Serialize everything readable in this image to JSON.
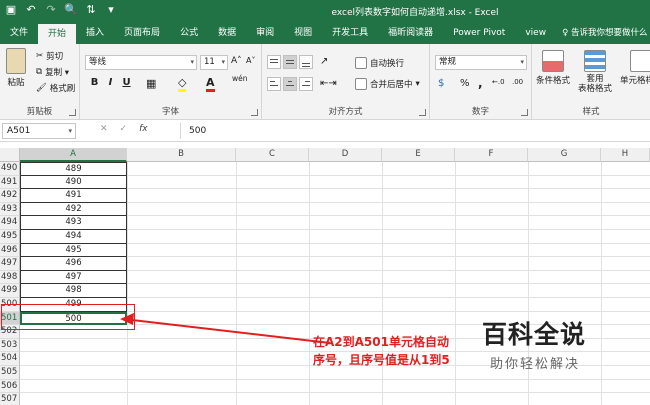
{
  "titlebar": {
    "title": "excel列表数字如何自动递增.xlsx  -  Excel",
    "qat": [
      "save-icon",
      "undo-icon",
      "redo-icon",
      "print-preview-icon",
      "sort-icon",
      "customize-icon"
    ],
    "qat_glyphs": [
      "▣",
      "↶",
      "↷",
      "🔍",
      "⇅",
      "▾"
    ]
  },
  "tabs": [
    "文件",
    "开始",
    "插入",
    "页面布局",
    "公式",
    "数据",
    "审阅",
    "视图",
    "开发工具",
    "福昕阅读器",
    "Power Pivot",
    "view"
  ],
  "tell_me": "♀ 告诉我你想要做什么",
  "ribbon": {
    "clipboard": {
      "paste": "粘贴",
      "cut": "剪切",
      "copy": "复制 ▾",
      "painter": "格式刷",
      "label": "剪贴板"
    },
    "font": {
      "name": "等线",
      "size": "11",
      "grow": "A˄",
      "shrink": "A˅",
      "bold": "B",
      "italic": "I",
      "underline": "U",
      "border": "▦",
      "fill": "◇",
      "color": "A",
      "wen": "wén",
      "label": "字体"
    },
    "alignment": {
      "wrap": "自动换行",
      "merge": "合并后居中",
      "label": "对齐方式"
    },
    "number": {
      "format": "常规",
      "currency": "$",
      "percent": "%",
      "comma": ",",
      "inc": "←.0",
      "dec": ".00",
      "label": "数字"
    },
    "styles": {
      "conditional": "条件格式",
      "table": "套用\n表格格式",
      "cell": "单元格样式",
      "label": "样式"
    }
  },
  "formula_bar": {
    "name_box": "A501",
    "cancel": "✕",
    "enter": "✓",
    "fx": "fx",
    "value": "500"
  },
  "columns": [
    "A",
    "B",
    "C",
    "D",
    "E",
    "F",
    "G",
    "H"
  ],
  "rows": [
    "490",
    "491",
    "492",
    "493",
    "494",
    "495",
    "496",
    "497",
    "498",
    "499",
    "500",
    "501",
    "502",
    "503",
    "504",
    "505",
    "506",
    "507"
  ],
  "cells": [
    "489",
    "490",
    "491",
    "492",
    "493",
    "494",
    "495",
    "496",
    "497",
    "498",
    "499",
    "500"
  ],
  "annotation": {
    "line1": "在A2到A501单元格自动",
    "line2": "序号，且序号值是从1到5",
    "color": "#e02020"
  },
  "watermark": {
    "title": "百科全说",
    "subtitle": "助你轻松解决"
  }
}
